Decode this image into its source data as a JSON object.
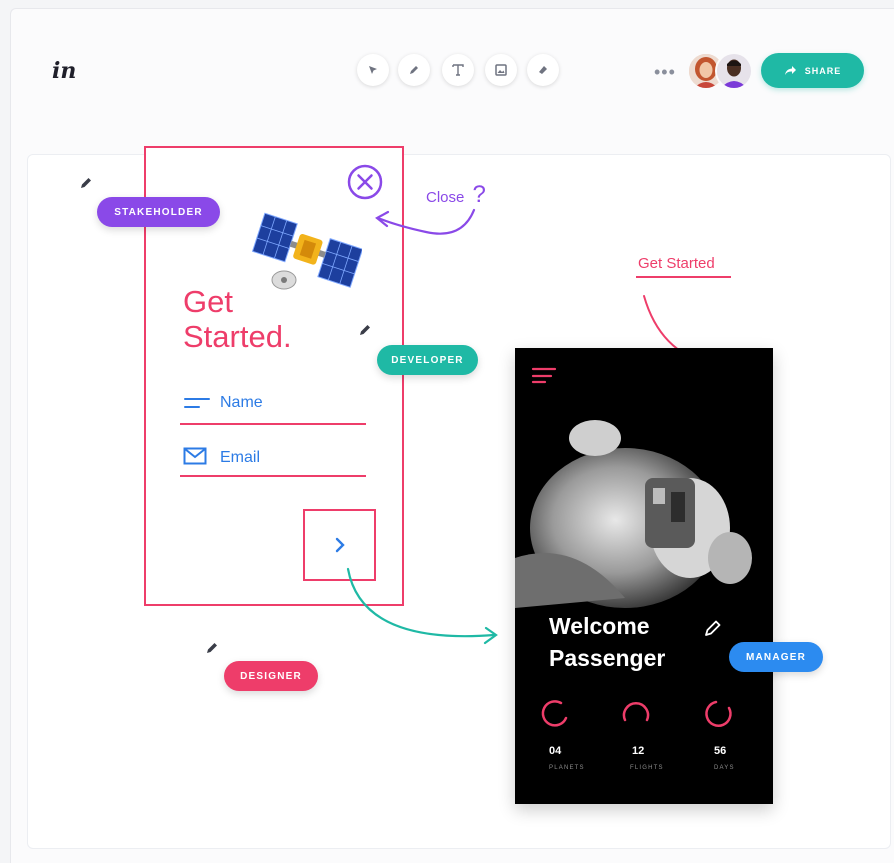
{
  "app": {
    "logo": "in",
    "tools": [
      "pointer-icon",
      "pen-icon",
      "text-icon",
      "image-icon",
      "eraser-icon"
    ],
    "more": "•••",
    "share_label": "SHARE",
    "accent": "#1fb9a5"
  },
  "tags": {
    "stakeholder": "STAKEHOLDER",
    "developer": "DEVELOPER",
    "designer": "DESIGNER",
    "manager": "MANAGER"
  },
  "screen1": {
    "title_line1": "Get",
    "title_line2": "Started.",
    "name_label": "Name",
    "email_label": "Email",
    "accent": "#ee3d6a"
  },
  "annotations": {
    "close": "Close",
    "close_mark": "?",
    "get_started": "Get Started"
  },
  "screen2": {
    "line1": "Welcome",
    "line2": "Passenger",
    "stats": [
      {
        "value": "04",
        "label": "PLANETS"
      },
      {
        "value": "12",
        "label": "FLIGHTS"
      },
      {
        "value": "56",
        "label": "DAYS"
      }
    ]
  }
}
